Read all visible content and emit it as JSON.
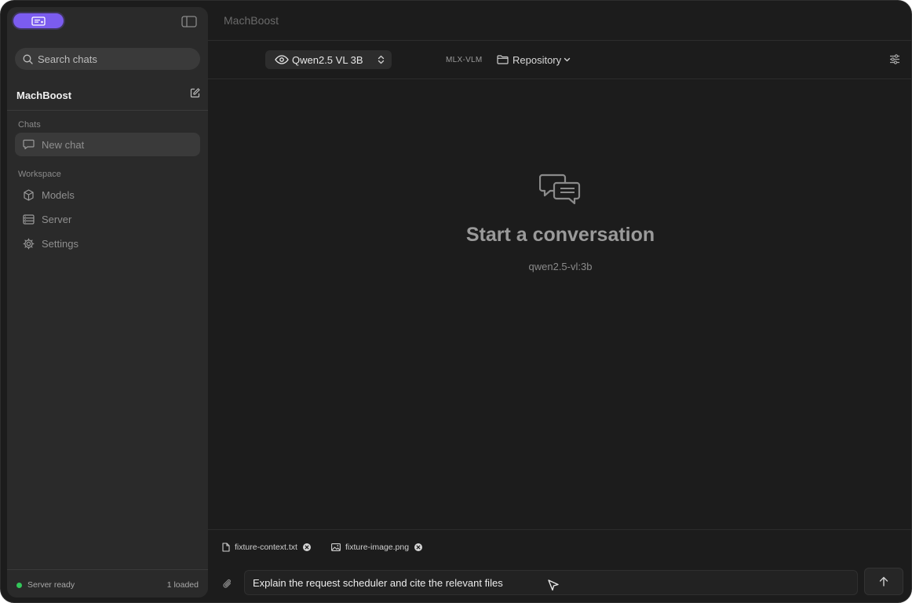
{
  "sidebar": {
    "search_placeholder": "Search chats",
    "brand": "MachBoost",
    "chats_label": "Chats",
    "new_chat": "New chat",
    "workspace_label": "Workspace",
    "workspace_items": [
      {
        "label": "Models",
        "icon": "cube-icon"
      },
      {
        "label": "Server",
        "icon": "server-icon"
      },
      {
        "label": "Settings",
        "icon": "gear-icon"
      }
    ],
    "status_text": "Server ready",
    "loaded_text": "1 loaded"
  },
  "header": {
    "title": "MachBoost",
    "model_name": "Qwen2.5 VL 3B",
    "backend": "MLX-VLM",
    "repository": "Repository"
  },
  "empty_state": {
    "title": "Start a conversation",
    "model_id": "qwen2.5-vl:3b"
  },
  "composer": {
    "attachments": [
      {
        "name": "fixture-context.txt",
        "icon": "file-icon"
      },
      {
        "name": "fixture-image.png",
        "icon": "image-icon"
      }
    ],
    "prompt_text": "Explain the request scheduler and cite the relevant files"
  },
  "colors": {
    "accent": "#7b5cf0",
    "status_ready": "#33c75a",
    "window_bg": "#1c1c1c",
    "sidebar_bg": "#2a2a2a"
  }
}
